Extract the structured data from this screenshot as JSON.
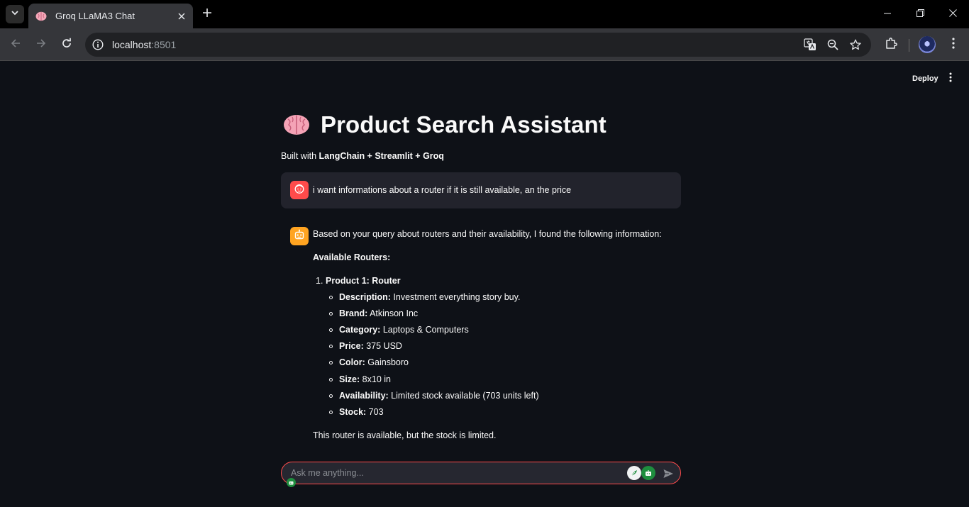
{
  "browser": {
    "tab_title": "Groq LLaMA3 Chat",
    "url_host": "localhost",
    "url_port": ":8501"
  },
  "app": {
    "deploy_label": "Deploy",
    "title": "Product Search Assistant",
    "subtitle_prefix": "Built with ",
    "subtitle_bold": "LangChain + Streamlit + Groq"
  },
  "messages": {
    "user": "i want informations about a router if it is still available, an the price",
    "bot": {
      "intro": "Based on your query about routers and their availability, I found the following information:",
      "section_heading": "Available Routers:",
      "item_number": "1.",
      "item_title": "Product 1: Router",
      "fields": [
        {
          "label": "Description:",
          "value": " Investment everything story buy."
        },
        {
          "label": "Brand:",
          "value": " Atkinson Inc"
        },
        {
          "label": "Category:",
          "value": " Laptops & Computers"
        },
        {
          "label": "Price:",
          "value": " 375 USD"
        },
        {
          "label": "Color:",
          "value": " Gainsboro"
        },
        {
          "label": "Size:",
          "value": " 8x10 in"
        },
        {
          "label": "Availability:",
          "value": " Limited stock available (703 units left)"
        },
        {
          "label": "Stock:",
          "value": " 703"
        }
      ],
      "conclusion": "This router is available, but the stock is limited."
    }
  },
  "chat_input": {
    "placeholder": "Ask me anything..."
  },
  "colors": {
    "background": "#0e1117",
    "accent": "#ff4b4b",
    "bot_avatar": "#ffa421",
    "user_bubble": "#262730"
  }
}
